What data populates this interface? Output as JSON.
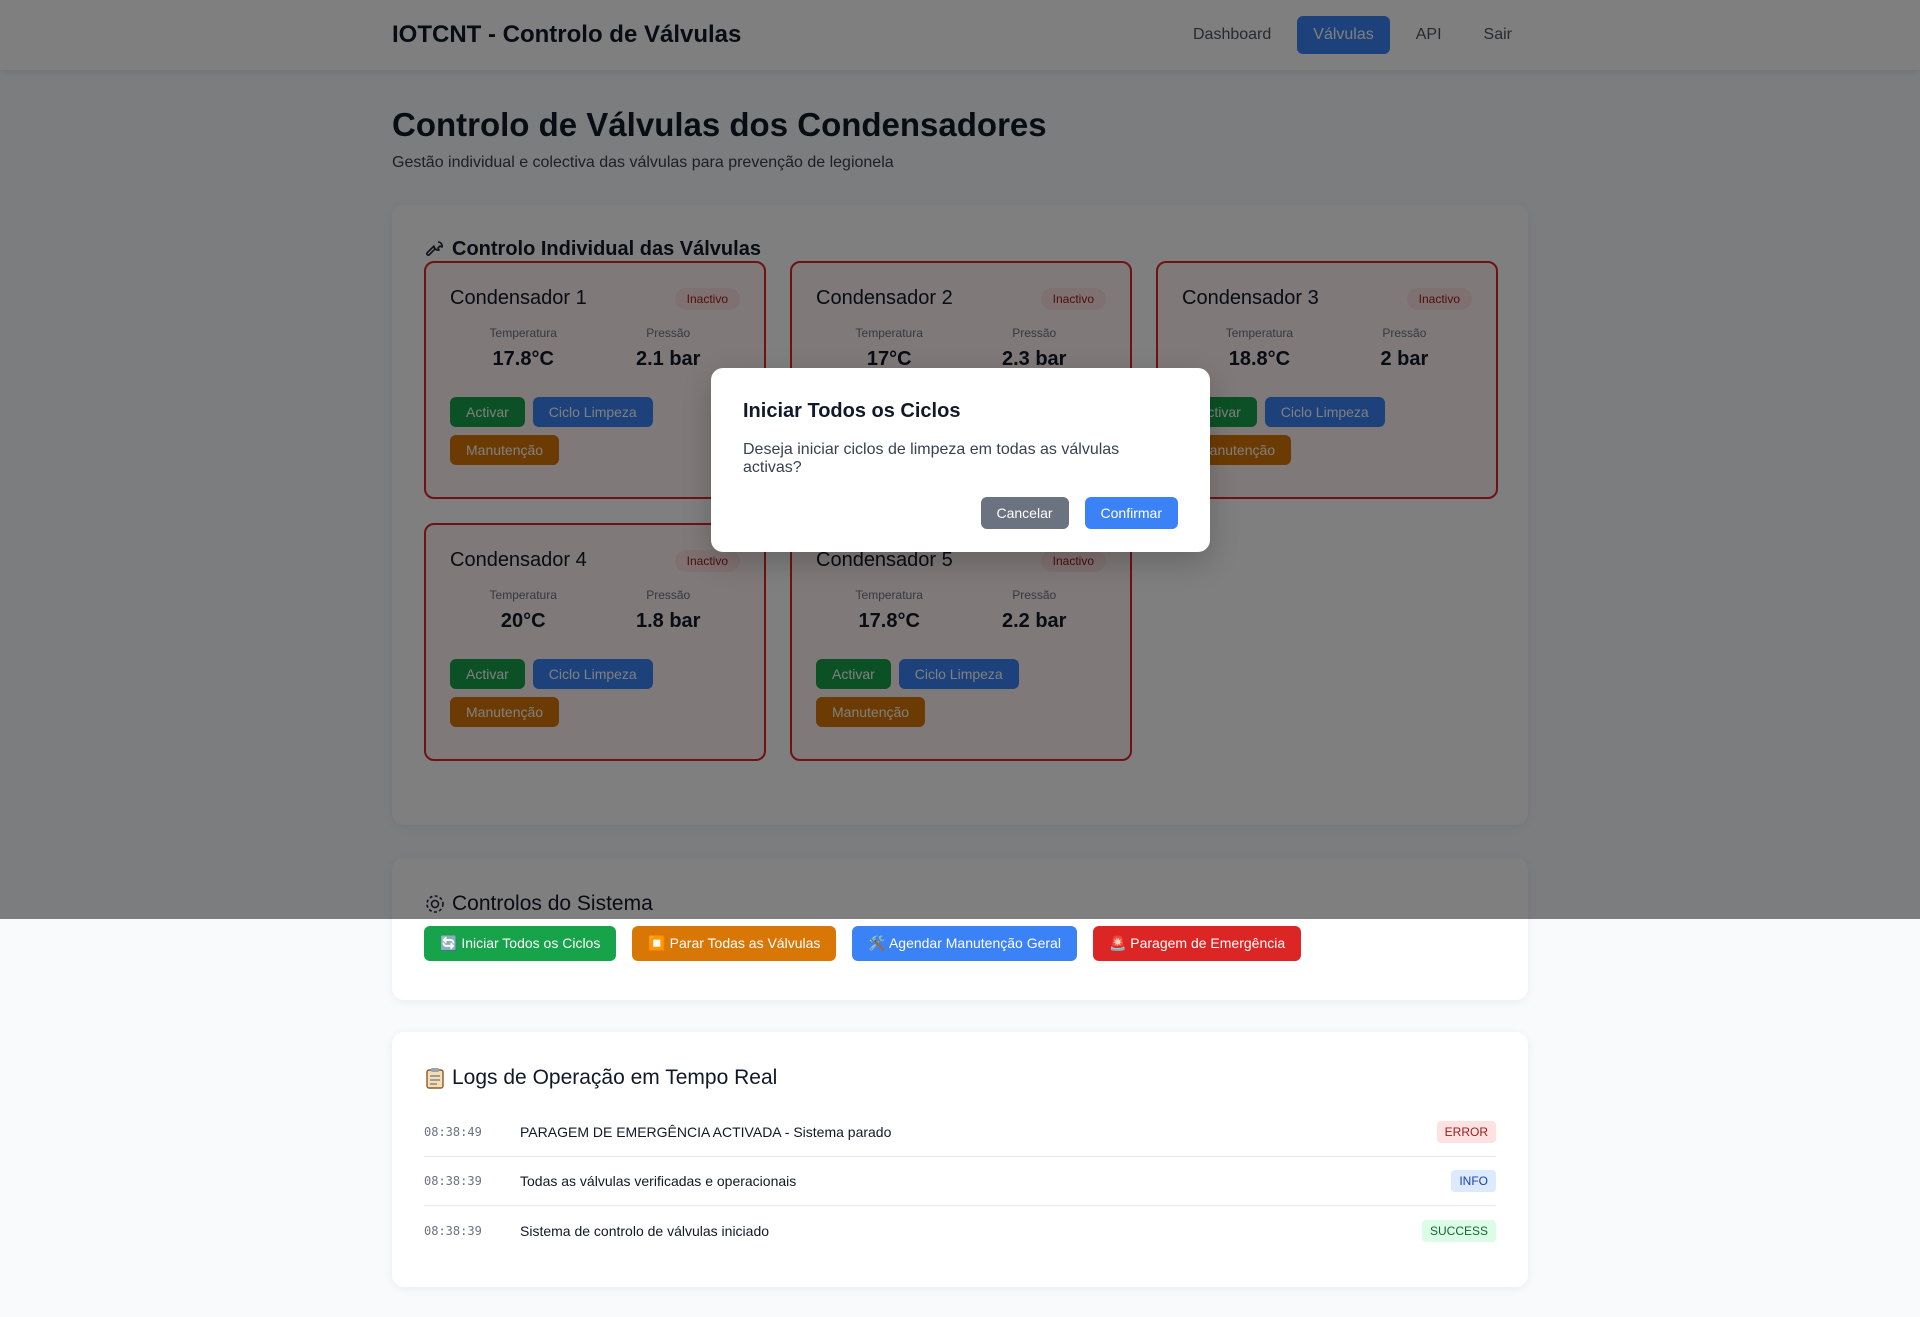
{
  "navbar": {
    "brand": "IOTCNT - Controlo de Válvulas",
    "links": [
      {
        "label": "Dashboard",
        "active": false
      },
      {
        "label": "Válvulas",
        "active": true
      },
      {
        "label": "API",
        "active": false
      },
      {
        "label": "Sair",
        "active": false
      }
    ]
  },
  "header": {
    "title": "Controlo de Válvulas dos Condensadores",
    "subtitle": "Gestão individual e colectiva das válvulas para prevenção de legionela"
  },
  "valves_section": {
    "icon": "wrench-icon",
    "title": "Controlo Individual das Válvulas",
    "temperature_label": "Temperatura",
    "pressure_label": "Pressão",
    "activate_label": "Activar",
    "clean_label": "Ciclo Limpeza",
    "maintenance_label": "Manutenção",
    "valves": [
      {
        "name": "Condensador 1",
        "status": "Inactivo",
        "temperature": "17.8°C",
        "pressure": "2.1 bar"
      },
      {
        "name": "Condensador 2",
        "status": "Inactivo",
        "temperature": "17°C",
        "pressure": "2.3 bar"
      },
      {
        "name": "Condensador 3",
        "status": "Inactivo",
        "temperature": "18.8°C",
        "pressure": "2 bar"
      },
      {
        "name": "Condensador 4",
        "status": "Inactivo",
        "temperature": "20°C",
        "pressure": "1.8 bar"
      },
      {
        "name": "Condensador 5",
        "status": "Inactivo",
        "temperature": "17.8°C",
        "pressure": "2.2 bar"
      }
    ],
    "colors": {
      "border": "#dc2626",
      "card_bg": "#fef2f2"
    }
  },
  "system_section": {
    "icon": "gear-icon",
    "title": "Controlos do Sistema",
    "buttons": {
      "start_all": "🔄 Iniciar Todos os Ciclos",
      "stop_all": "⏹️ Parar Todas as Válvulas",
      "schedule_maintenance": "🛠️ Agendar Manutenção Geral",
      "emergency_stop": "🚨 Paragem de Emergência"
    }
  },
  "logs_section": {
    "icon": "clipboard-icon",
    "title": "Logs de Operação em Tempo Real",
    "entries": [
      {
        "time": "08:38:49",
        "message": "PARAGEM DE EMERGÊNCIA ACTIVADA - Sistema parado",
        "level": "ERROR"
      },
      {
        "time": "08:38:39",
        "message": "Todas as válvulas verificadas e operacionais",
        "level": "INFO"
      },
      {
        "time": "08:38:39",
        "message": "Sistema de controlo de válvulas iniciado",
        "level": "SUCCESS"
      }
    ]
  },
  "modal": {
    "title": "Iniciar Todos os Ciclos",
    "message": "Deseja iniciar ciclos de limpeza em todas as válvulas activas?",
    "cancel_label": "Cancelar",
    "confirm_label": "Confirmar"
  }
}
